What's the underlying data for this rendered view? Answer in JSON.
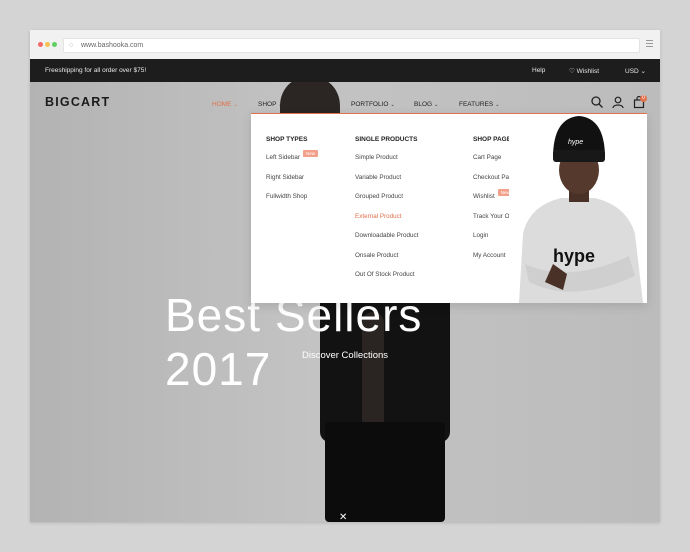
{
  "browser": {
    "url": "www.bashooka.com"
  },
  "topbar": {
    "promo": "Freeshipping for all order over $75!",
    "help": "Help",
    "wishlist": "♡ Wishlist",
    "currency": "USD ⌄"
  },
  "header": {
    "logo": "BIGCART",
    "nav": [
      {
        "label": "HOME",
        "active": true
      },
      {
        "label": "SHOP",
        "active": false
      },
      {
        "label": "PORTFOLIO",
        "active": false
      },
      {
        "label": "BLOG",
        "active": false
      },
      {
        "label": "FEATURES",
        "active": false
      }
    ],
    "cart_count": "0"
  },
  "hero": {
    "title": "Best Sellers 2017",
    "cta": "Discover Collections"
  },
  "megamenu": {
    "columns": [
      {
        "title": "SHOP TYPES",
        "items": [
          {
            "label": "Left Sidebar",
            "badge": "New"
          },
          {
            "label": "Right Sidebar"
          },
          {
            "label": "Fullwidth Shop"
          }
        ]
      },
      {
        "title": "SINGLE PRODUCTS",
        "items": [
          {
            "label": "Simple Product"
          },
          {
            "label": "Variable Product"
          },
          {
            "label": "Grouped Product"
          },
          {
            "label": "External Product"
          },
          {
            "label": "Downloadable Product"
          },
          {
            "label": "Onsale Product"
          },
          {
            "label": "Out Of Stock Product"
          }
        ]
      },
      {
        "title": "SHOP PAGES",
        "items": [
          {
            "label": "Cart Page"
          },
          {
            "label": "Checkout Page"
          },
          {
            "label": "Wishlist",
            "badge": "New"
          },
          {
            "label": "Track Your Order"
          },
          {
            "label": "Login"
          },
          {
            "label": "My Account"
          }
        ]
      }
    ],
    "photo_print": "hype"
  },
  "colors": {
    "accent": "#e2704a",
    "topbar": "#1d1d1d"
  }
}
